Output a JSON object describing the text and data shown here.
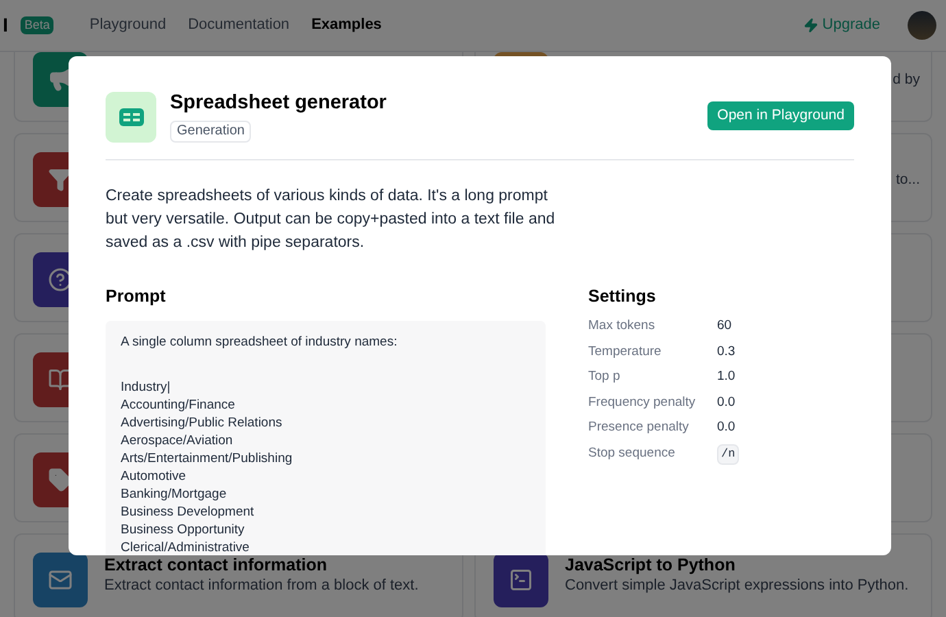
{
  "nav": {
    "logo": "I",
    "badge": "Beta",
    "links": [
      {
        "label": "Playground",
        "selected": false
      },
      {
        "label": "Documentation",
        "selected": false
      },
      {
        "label": "Examples",
        "selected": true
      }
    ],
    "upgrade": "Upgrade"
  },
  "cards": {
    "right_fragments": [
      "d by",
      "to..."
    ],
    "bottom": [
      {
        "title": "Extract contact information",
        "description": "Extract contact information from a block of text."
      },
      {
        "title": "JavaScript to Python",
        "description": "Convert simple JavaScript expressions into Python."
      }
    ]
  },
  "modal": {
    "title": "Spreadsheet generator",
    "tag": "Generation",
    "button": "Open in Playground",
    "description": "Create spreadsheets of various kinds of data. It's a long prompt but very versatile. Output can be copy+pasted into a text file and saved as a .csv with pipe separators.",
    "prompt_heading": "Prompt",
    "prompt_intro": "A single column spreadsheet of industry names:",
    "prompt_lines": [
      "Industry|",
      "Accounting/Finance",
      "Advertising/Public Relations",
      "Aerospace/Aviation",
      "Arts/Entertainment/Publishing",
      "Automotive",
      "Banking/Mortgage",
      "Business Development",
      "Business Opportunity",
      "Clerical/Administrative"
    ],
    "settings_heading": "Settings",
    "settings": [
      {
        "label": "Max tokens",
        "value": "60",
        "kind": "text"
      },
      {
        "label": "Temperature",
        "value": "0.3",
        "kind": "text"
      },
      {
        "label": "Top p",
        "value": "1.0",
        "kind": "text"
      },
      {
        "label": "Frequency penalty",
        "value": "0.0",
        "kind": "text"
      },
      {
        "label": "Presence penalty",
        "value": "0.0",
        "kind": "text"
      },
      {
        "label": "Stop sequence",
        "value": "/n",
        "kind": "code"
      }
    ]
  }
}
